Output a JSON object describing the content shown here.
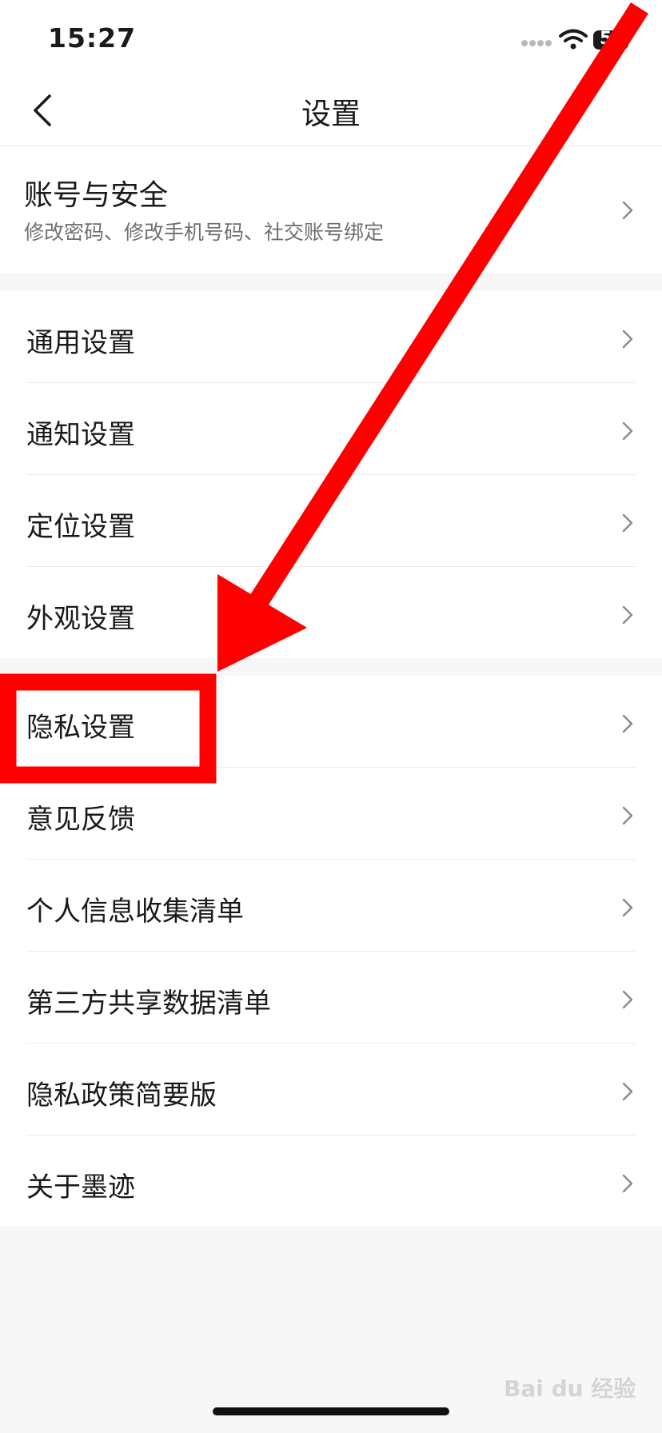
{
  "status_bar": {
    "time": "15:27",
    "battery": "5"
  },
  "nav": {
    "title": "设置",
    "back_icon": "chevron-left-icon"
  },
  "account": {
    "title": "账号与安全",
    "subtitle": "修改密码、修改手机号码、社交账号绑定"
  },
  "group_general": [
    {
      "label": "通用设置"
    },
    {
      "label": "通知设置"
    },
    {
      "label": "定位设置"
    },
    {
      "label": "外观设置"
    }
  ],
  "group_privacy": [
    {
      "label": "隐私设置"
    },
    {
      "label": "意见反馈"
    },
    {
      "label": "个人信息收集清单"
    },
    {
      "label": "第三方共享数据清单"
    },
    {
      "label": "隐私政策简要版"
    },
    {
      "label": "关于墨迹"
    }
  ],
  "annotation": {
    "color": "#ff0000"
  },
  "watermark": "Bai du 经验"
}
